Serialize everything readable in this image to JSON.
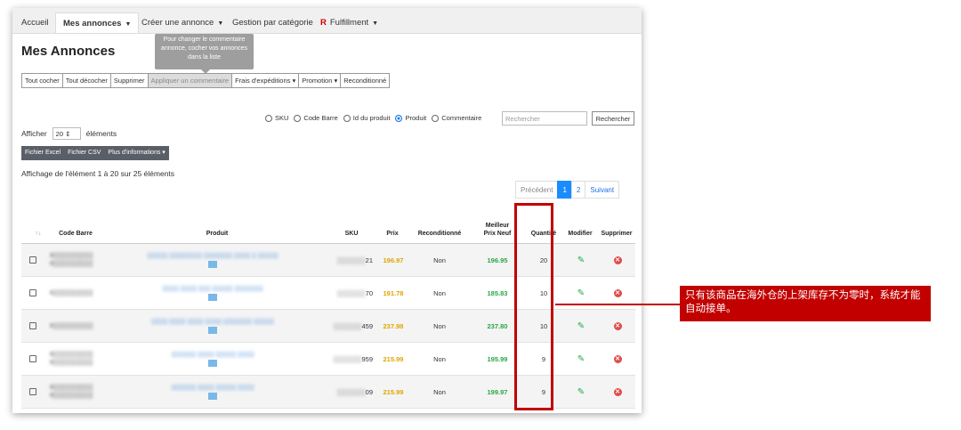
{
  "nav": {
    "tabs": [
      {
        "label": "Accueil"
      },
      {
        "label": "Mes annonces"
      },
      {
        "label": "Créer une annonce"
      },
      {
        "label": "Gestion par catégorie"
      },
      {
        "label": "Fulfillment"
      }
    ],
    "logo_letter": "R"
  },
  "page_title": "Mes Annonces",
  "tooltip": "Pour changer le commentaire annonce, cocher vos annonces dans la liste",
  "actions": [
    {
      "label": "Tout cocher"
    },
    {
      "label": "Tout décocher"
    },
    {
      "label": "Supprimer"
    },
    {
      "label": "Appliquer un commentaire"
    },
    {
      "label": "Frais d'expéditions ▾"
    },
    {
      "label": "Promotion ▾"
    },
    {
      "label": "Reconditionné"
    }
  ],
  "filters": {
    "options": [
      "SKU",
      "Code Barre",
      "Id du produit",
      "Produit",
      "Commentaire"
    ],
    "selected": "Produit",
    "search_placeholder": "Rechercher",
    "search_button": "Rechercher"
  },
  "show": {
    "prefix": "Afficher",
    "value": "20",
    "suffix": "éléments"
  },
  "exports": {
    "excel": "Fichier Excel",
    "csv": "Fichier CSV",
    "more": "Plus d'informations ▾"
  },
  "info_text": "Affichage de l'élément 1 à 20 sur 25 éléments",
  "pagination": {
    "prev": "Précédent",
    "pages": [
      "1",
      "2"
    ],
    "next": "Suivant"
  },
  "table": {
    "headers": {
      "sort": "↑↓",
      "barcode": "Code Barre",
      "product": "Produit",
      "sku": "SKU",
      "price": "Prix",
      "recond": "Reconditionné",
      "best_price_1": "Meilleur",
      "best_price_2": "Prix Neuf",
      "qty": "Quantité",
      "edit": "Modifier",
      "delete": "Supprimer"
    },
    "rows": [
      {
        "barcode": "8▒▒▒▒▒▒▒▒▒\n8▒▒▒▒▒▒▒▒▒",
        "product": "▒▒▒▒▒ ▒▒▒▒▒▒▒▒ ▒▒▒▒▒▒▒ ▒▒▒▒ ▒ ▒▒▒▒▒",
        "sku_suffix": "21",
        "price": "196.97",
        "recond": "Non",
        "best_price": "196.95",
        "qty": "20"
      },
      {
        "barcode": "6▒▒▒▒▒▒▒▒▒",
        "product": "▒▒▒▒ ▒▒▒▒ ▒▒▒ ▒▒▒▒▒ ▒▒▒▒▒▒▒",
        "sku_suffix": "70",
        "price": "191.78",
        "recond": "Non",
        "best_price": "185.83",
        "qty": "10"
      },
      {
        "barcode": "6▒▒▒▒▒▒▒▒▒",
        "product": "▒▒▒▒ ▒▒▒▒ ▒▒▒▒ ▒▒▒▒ ▒▒▒▒▒▒▒ ▒▒▒▒▒",
        "sku_suffix": "459",
        "price": "237.98",
        "recond": "Non",
        "best_price": "237.80",
        "qty": "10"
      },
      {
        "barcode": "8▒▒▒▒▒▒▒▒▒\n8▒▒▒▒▒▒▒▒▒",
        "product": "▒▒▒▒▒▒ ▒▒▒▒ ▒▒▒▒▒ ▒▒▒▒",
        "sku_suffix": "959",
        "price": "215.99",
        "recond": "Non",
        "best_price": "195.99",
        "qty": "9"
      },
      {
        "barcode": "8▒▒▒▒▒▒▒▒▒\n8▒▒▒▒▒▒▒▒▒",
        "product": "▒▒▒▒▒▒ ▒▒▒▒ ▒▒▒▒▒ ▒▒▒▒",
        "sku_suffix": "09",
        "price": "215.99",
        "recond": "Non",
        "best_price": "199.97",
        "qty": "9"
      }
    ]
  },
  "annotation": {
    "text": "只有该商品在海外仓的上架库存不为零时，系统才能自动接单。",
    "color": "#c20000"
  },
  "colors": {
    "price_orange": "#e0a500",
    "price_green": "#28a745",
    "accent_blue": "#1a8cff"
  }
}
